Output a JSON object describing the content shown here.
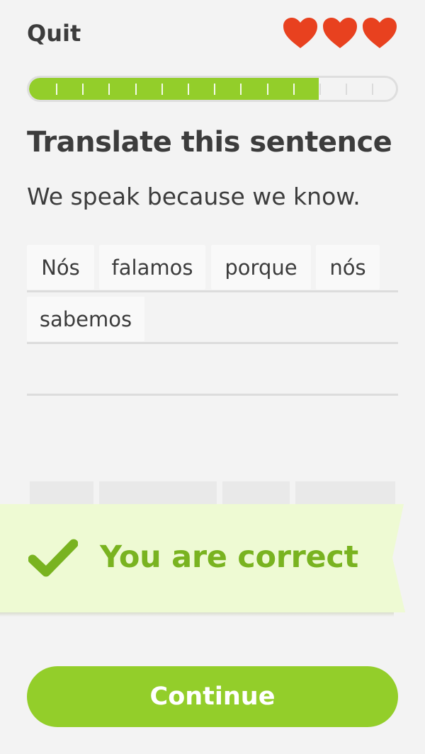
{
  "header": {
    "quit_label": "Quit",
    "hearts": [
      "heart-icon",
      "heart-icon",
      "heart-icon"
    ],
    "heart_color": "#e8411f"
  },
  "progress": {
    "completed_fraction": 0.79,
    "fill_color": "#93ce2a"
  },
  "exercise": {
    "title": "Translate this sentence",
    "sentence": "We speak because we know.",
    "answer_words": [
      "Nós",
      "falamos",
      "porque",
      "nós",
      "sabemos"
    ]
  },
  "feedback": {
    "icon": "checkmark-icon",
    "message": "You are correct",
    "color": "#79b320",
    "background": "#eefad3"
  },
  "footer": {
    "continue_label": "Continue",
    "button_color": "#93ce2a"
  }
}
